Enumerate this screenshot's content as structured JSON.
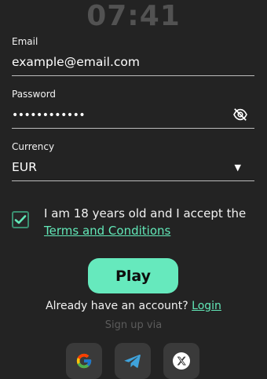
{
  "status": {
    "time": "07:41"
  },
  "form": {
    "email": {
      "label": "Email",
      "value": "example@email.com"
    },
    "password": {
      "label": "Password",
      "value": "••••••••••••",
      "toggle_icon": "eye-off-icon"
    },
    "currency": {
      "label": "Currency",
      "value": "EUR",
      "dropdown_icon": "caret-down-icon"
    },
    "consent": {
      "checked": true,
      "text": "I am 18 years old and I accept the",
      "link": "Terms and Conditions"
    },
    "play_label": "Play",
    "login_prompt": "Already have an account?",
    "login_link": "Login",
    "signup_via": "Sign up via",
    "social_icons": [
      "google-icon",
      "telegram-icon",
      "x-icon"
    ]
  },
  "colors": {
    "background": "#232323",
    "accent": "#66e9bd",
    "link": "#62e8b8",
    "muted": "#5c5c5c"
  }
}
